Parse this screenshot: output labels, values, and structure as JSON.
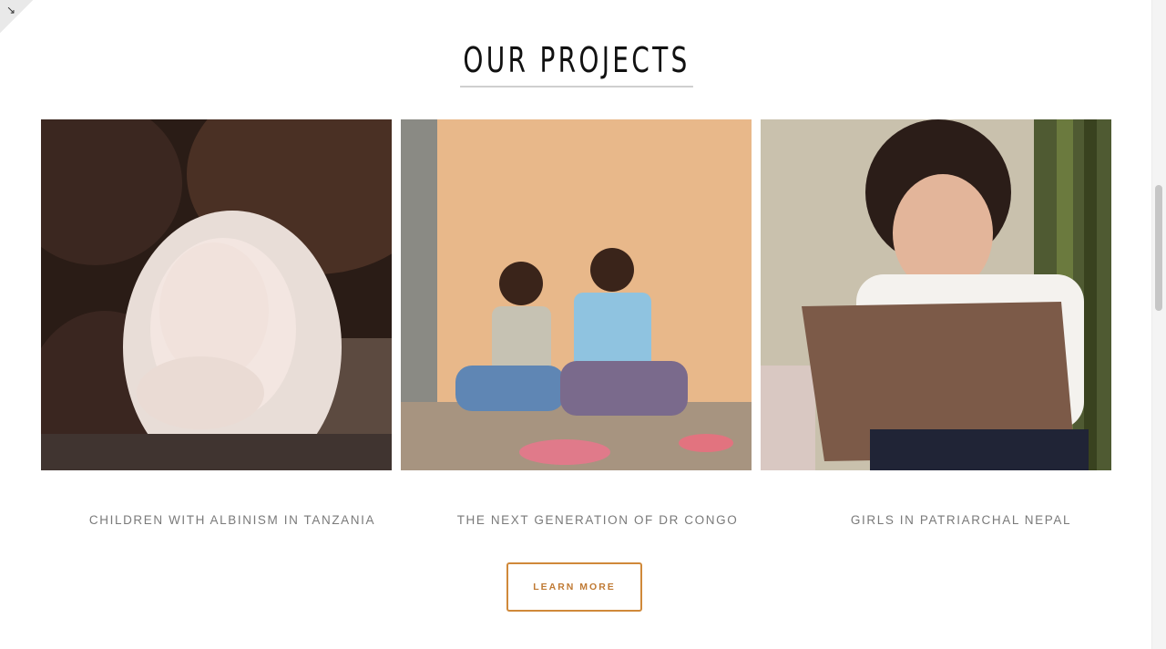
{
  "section": {
    "title": "OUR PROJECTS"
  },
  "projects": [
    {
      "caption": "CHILDREN WITH ALBINISM IN TANZANIA"
    },
    {
      "caption": "THE NEXT GENERATION OF DR CONGO"
    },
    {
      "caption": "GIRLS IN PATRIARCHAL NEPAL"
    }
  ],
  "cta": {
    "label": "LEARN MORE"
  },
  "colors": {
    "accent": "#c07a34",
    "caption": "#7a7a7a",
    "heading": "#111111"
  },
  "icons": [
    "collapse-arrow-icon"
  ]
}
